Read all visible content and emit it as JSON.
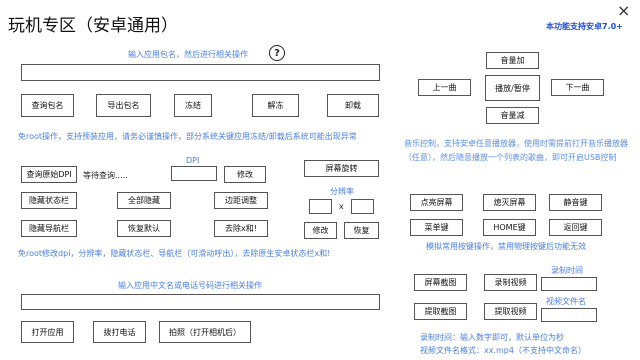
{
  "app": {
    "title": "玩机专区（安卓通用）",
    "close_glyph": "×",
    "support_note": "本功能支持安卓7.0+"
  },
  "package_section": {
    "hint": "输入应用包名，然后进行相关操作",
    "help_glyph": "?",
    "input_value": "",
    "buttons": [
      "查询包名",
      "导出包名",
      "冻结",
      "解冻",
      "卸载"
    ],
    "note": "免root操作，支持预装应用，请务必谨慎操作，部分系统关键应用冻结/卸载后系统可能出现异常"
  },
  "dpi_section": {
    "query_dpi": "查询原始DPI",
    "waiting": "等待查询.....",
    "dpi_label": "DPI",
    "dpi_value": "",
    "modify": "修改",
    "rotate": "屏幕旋转",
    "resolution_label": "分辨率",
    "resolution_sep": "x",
    "res_width": "",
    "res_height": "",
    "row2_buttons": [
      "隐藏状态栏",
      "全部隐藏",
      "边距调整"
    ],
    "row3_buttons": [
      "隐藏导航栏",
      "恢复默认",
      "去除x和!"
    ],
    "res_modify": "修改",
    "res_restore": "恢复",
    "note": "免root修改dpi，分辨率，隐藏状态栏、导航栏（可滑动呼出），去除原生安卓状态栏x和!"
  },
  "app_launch_section": {
    "hint": "输入应用中文名或电话号码进行相关操作",
    "input_value": "",
    "buttons": [
      "打开应用",
      "拨打电话",
      "拍照（打开相机后）"
    ]
  },
  "music_section": {
    "volume_up": "音量加",
    "prev": "上一曲",
    "play_pause": "播放/暂停",
    "next": "下一曲",
    "volume_down": "音量减",
    "note": "音乐控制，支持安卓任意播放器，使用时需提前打开音乐播放器（任意），然后随意播放一个列表的歌曲，即可开启USB控制"
  },
  "keys_section": {
    "row1": [
      "点亮屏幕",
      "熄灭屏幕",
      "静音键"
    ],
    "row2": [
      "菜单键",
      "HOME键",
      "返回键"
    ],
    "note": "模拟常用按键操作，禁用物理按键后功能无效"
  },
  "capture_section": {
    "screenshot": "屏幕截图",
    "record": "录制视频",
    "record_time_label": "录制时间",
    "record_time_value": "",
    "pull_screenshot": "提取截图",
    "pull_video": "提取视频",
    "video_name_label": "视频文件名",
    "video_name_value": "",
    "note1": "录制时间：输入数字即可，默认单位为秒",
    "note2": "视频文件名格式：xx.mp4（不支持中文命名）"
  }
}
